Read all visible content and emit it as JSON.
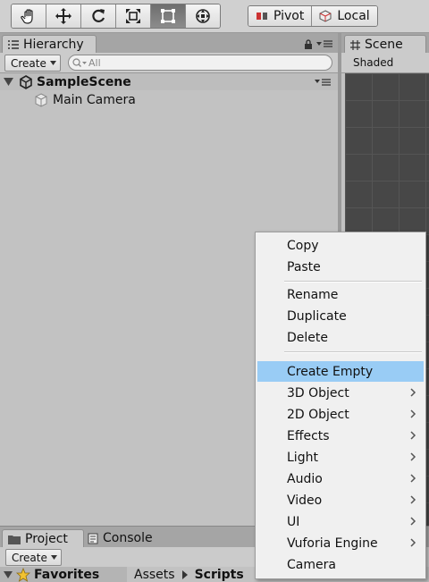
{
  "toolbar": {
    "tools": [
      {
        "name": "hand-tool-icon",
        "active": false
      },
      {
        "name": "move-tool-icon",
        "active": false
      },
      {
        "name": "rotate-tool-icon",
        "active": false
      },
      {
        "name": "scale-tool-icon",
        "active": false
      },
      {
        "name": "rect-tool-icon",
        "active": true
      },
      {
        "name": "transform-tool-icon",
        "active": false
      }
    ],
    "pivot_label": "Pivot",
    "local_label": "Local"
  },
  "hierarchy": {
    "tab_label": "Hierarchy",
    "create_label": "Create",
    "search_placeholder": "All",
    "scene_name": "SampleScene",
    "items": [
      "Main Camera"
    ]
  },
  "scene": {
    "tab_label": "Scene",
    "shading_mode": "Shaded"
  },
  "project": {
    "tabs": [
      "Project",
      "Console"
    ],
    "create_label": "Create",
    "favorites_label": "Favorites",
    "breadcrumb": [
      "Assets",
      "Scripts"
    ]
  },
  "context_menu": {
    "groups": [
      [
        {
          "label": "Copy"
        },
        {
          "label": "Paste"
        }
      ],
      [
        {
          "label": "Rename"
        },
        {
          "label": "Duplicate"
        },
        {
          "label": "Delete"
        }
      ],
      [
        {
          "label": "Create Empty",
          "highlighted": true
        },
        {
          "label": "3D Object",
          "submenu": true
        },
        {
          "label": "2D Object",
          "submenu": true
        },
        {
          "label": "Effects",
          "submenu": true
        },
        {
          "label": "Light",
          "submenu": true
        },
        {
          "label": "Audio",
          "submenu": true
        },
        {
          "label": "Video",
          "submenu": true
        },
        {
          "label": "UI",
          "submenu": true
        },
        {
          "label": "Vuforia Engine",
          "submenu": true
        },
        {
          "label": "Camera"
        }
      ]
    ]
  },
  "colors": {
    "menu_highlight": "#99ccf5",
    "panel_bg": "#c2c2c2",
    "scene_bg": "#474747"
  }
}
